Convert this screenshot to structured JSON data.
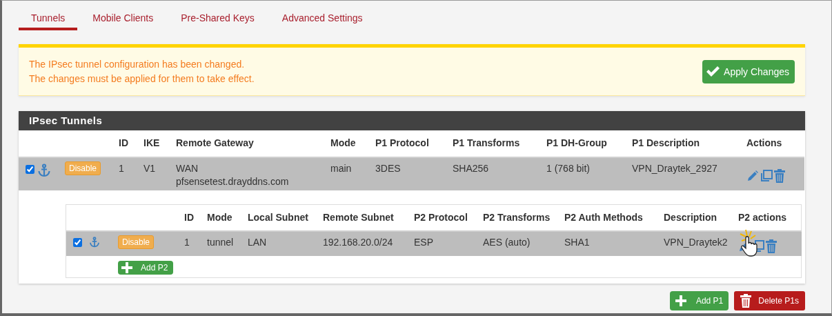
{
  "tabs": [
    {
      "label": "Tunnels",
      "selected": true
    },
    {
      "label": "Mobile Clients",
      "selected": false
    },
    {
      "label": "Pre-Shared Keys",
      "selected": false
    },
    {
      "label": "Advanced Settings",
      "selected": false
    }
  ],
  "alert": {
    "lines": [
      "The IPsec tunnel configuration has been changed.",
      "The changes must be applied for them to take effect."
    ],
    "button": "Apply Changes"
  },
  "panel": {
    "title": "IPsec Tunnels",
    "columns": [
      "ID",
      "IKE",
      "Remote Gateway",
      "Mode",
      "P1 Protocol",
      "P1 Transforms",
      "P1 DH-Group",
      "P1 Description",
      "Actions"
    ],
    "rows": [
      {
        "checked": true,
        "toggle": "Disable",
        "id": "1",
        "ike": "V1",
        "gateway": [
          "WAN",
          "pfsensetest.drayddns.com"
        ],
        "mode": "main",
        "protocol": "3DES",
        "transforms": "SHA256",
        "dh_group": "1 (768 bit)",
        "description": "VPN_Draytek_2927",
        "phase2": {
          "columns": [
            "ID",
            "Mode",
            "Local Subnet",
            "Remote Subnet",
            "P2 Protocol",
            "P2 Transforms",
            "P2 Auth Methods",
            "Description",
            "P2 actions"
          ],
          "rows": [
            {
              "checked": true,
              "toggle": "Disable",
              "id": "1",
              "mode": "tunnel",
              "local": "LAN",
              "remote": "192.168.20.0/24",
              "protocol": "ESP",
              "transforms": "AES (auto)",
              "auth": "SHA1",
              "description": "VPN_Draytek2"
            }
          ],
          "add_button": "Add P2"
        }
      }
    ]
  },
  "footer": {
    "add_button": "Add P1",
    "delete_button": "Delete P1s"
  }
}
